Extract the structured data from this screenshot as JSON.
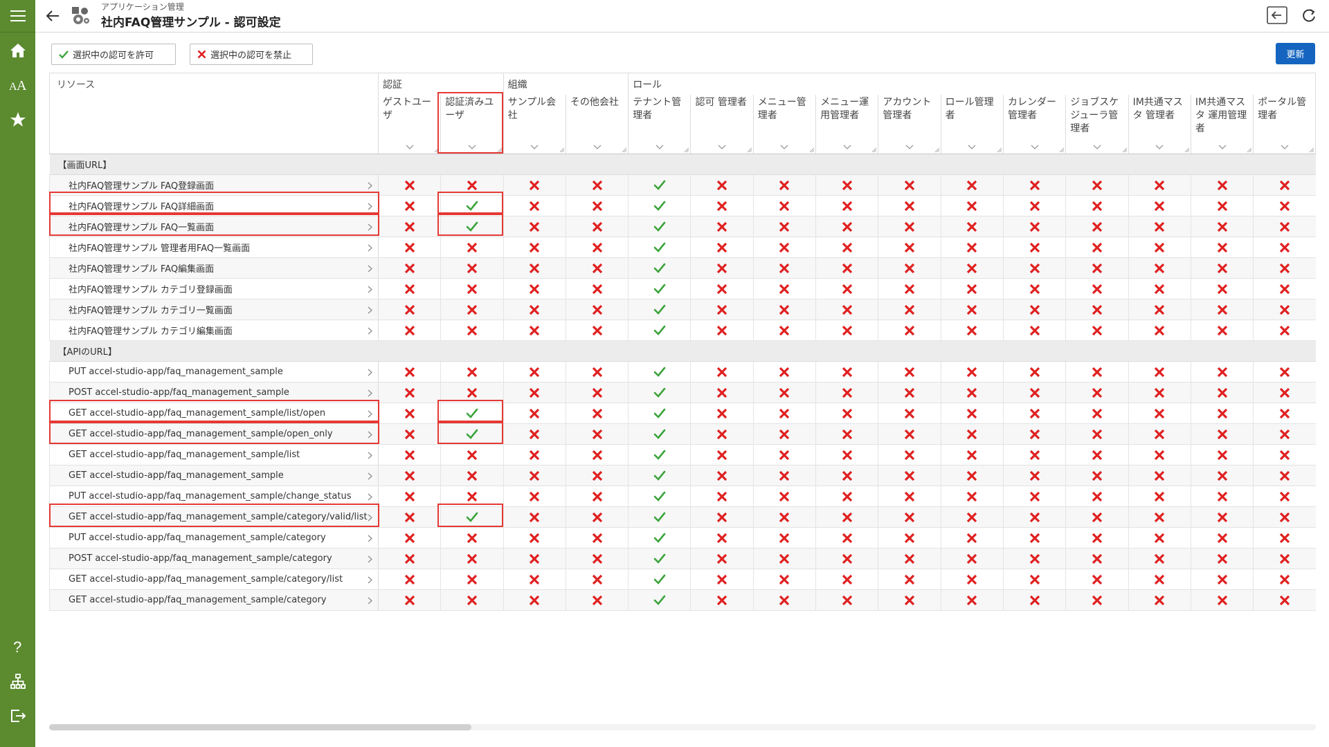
{
  "sidebar": {
    "icons": [
      "menu-icon",
      "home-icon",
      "font-size-icon",
      "star-icon",
      "help-icon",
      "sitemap-icon",
      "logout-icon"
    ]
  },
  "header": {
    "subtitle": "アプリケーション管理",
    "title": "社内FAQ管理サンプル - 認可設定"
  },
  "toolbar": {
    "allow_label": "選択中の認可を許可",
    "deny_label": "選択中の認可を禁止",
    "update_label": "更新"
  },
  "colors": {
    "sidebar": "#5b8a2f",
    "check": "#3aa33a",
    "cross": "#e02020",
    "primary": "#1565c0",
    "highlight": "#e53935"
  },
  "table": {
    "resource_header": "リソース",
    "groups": [
      {
        "label": "認証"
      },
      {
        "label": "組織"
      },
      {
        "label": "ロール"
      }
    ],
    "columns": [
      "ゲストユーザ",
      "認証済みユーザ",
      "サンプル会社",
      "その他会社",
      "テナント管理者",
      "認可 管理者",
      "メニュー管理者",
      "メニュー運用管理者",
      "アカウント管理者",
      "ロール管理者",
      "カレンダー管理者",
      "ジョブスケジューラ管理者",
      "IM共通マスタ 管理者",
      "IM共通マスタ 運用管理者",
      "ポータル管理者"
    ],
    "sections": [
      {
        "label": "【画面URL】",
        "rows": [
          {
            "resource": "社内FAQ管理サンプル FAQ登録画面",
            "auth": [
              "x",
              "x",
              "x",
              "x",
              "ok",
              "x",
              "x",
              "x",
              "x",
              "x",
              "x",
              "x",
              "x",
              "x",
              "x"
            ]
          },
          {
            "resource": "社内FAQ管理サンプル FAQ詳細画面",
            "auth": [
              "x",
              "ok",
              "x",
              "x",
              "ok",
              "x",
              "x",
              "x",
              "x",
              "x",
              "x",
              "x",
              "x",
              "x",
              "x"
            ]
          },
          {
            "resource": "社内FAQ管理サンプル FAQ一覧画面",
            "auth": [
              "x",
              "ok",
              "x",
              "x",
              "ok",
              "x",
              "x",
              "x",
              "x",
              "x",
              "x",
              "x",
              "x",
              "x",
              "x"
            ]
          },
          {
            "resource": "社内FAQ管理サンプル 管理者用FAQ一覧画面",
            "auth": [
              "x",
              "x",
              "x",
              "x",
              "ok",
              "x",
              "x",
              "x",
              "x",
              "x",
              "x",
              "x",
              "x",
              "x",
              "x"
            ]
          },
          {
            "resource": "社内FAQ管理サンプル FAQ編集画面",
            "auth": [
              "x",
              "x",
              "x",
              "x",
              "ok",
              "x",
              "x",
              "x",
              "x",
              "x",
              "x",
              "x",
              "x",
              "x",
              "x"
            ]
          },
          {
            "resource": "社内FAQ管理サンプル カテゴリ登録画面",
            "auth": [
              "x",
              "x",
              "x",
              "x",
              "ok",
              "x",
              "x",
              "x",
              "x",
              "x",
              "x",
              "x",
              "x",
              "x",
              "x"
            ]
          },
          {
            "resource": "社内FAQ管理サンプル カテゴリ一覧画面",
            "auth": [
              "x",
              "x",
              "x",
              "x",
              "ok",
              "x",
              "x",
              "x",
              "x",
              "x",
              "x",
              "x",
              "x",
              "x",
              "x"
            ]
          },
          {
            "resource": "社内FAQ管理サンプル カテゴリ編集画面",
            "auth": [
              "x",
              "x",
              "x",
              "x",
              "ok",
              "x",
              "x",
              "x",
              "x",
              "x",
              "x",
              "x",
              "x",
              "x",
              "x"
            ]
          }
        ]
      },
      {
        "label": "【APIのURL】",
        "rows": [
          {
            "resource": "PUT accel-studio-app/faq_management_sample",
            "auth": [
              "x",
              "x",
              "x",
              "x",
              "ok",
              "x",
              "x",
              "x",
              "x",
              "x",
              "x",
              "x",
              "x",
              "x",
              "x"
            ]
          },
          {
            "resource": "POST accel-studio-app/faq_management_sample",
            "auth": [
              "x",
              "x",
              "x",
              "x",
              "ok",
              "x",
              "x",
              "x",
              "x",
              "x",
              "x",
              "x",
              "x",
              "x",
              "x"
            ]
          },
          {
            "resource": "GET accel-studio-app/faq_management_sample/list/open",
            "auth": [
              "x",
              "ok",
              "x",
              "x",
              "ok",
              "x",
              "x",
              "x",
              "x",
              "x",
              "x",
              "x",
              "x",
              "x",
              "x"
            ]
          },
          {
            "resource": "GET accel-studio-app/faq_management_sample/open_only",
            "auth": [
              "x",
              "ok",
              "x",
              "x",
              "ok",
              "x",
              "x",
              "x",
              "x",
              "x",
              "x",
              "x",
              "x",
              "x",
              "x"
            ]
          },
          {
            "resource": "GET accel-studio-app/faq_management_sample/list",
            "auth": [
              "x",
              "x",
              "x",
              "x",
              "ok",
              "x",
              "x",
              "x",
              "x",
              "x",
              "x",
              "x",
              "x",
              "x",
              "x"
            ]
          },
          {
            "resource": "GET accel-studio-app/faq_management_sample",
            "auth": [
              "x",
              "x",
              "x",
              "x",
              "ok",
              "x",
              "x",
              "x",
              "x",
              "x",
              "x",
              "x",
              "x",
              "x",
              "x"
            ]
          },
          {
            "resource": "PUT accel-studio-app/faq_management_sample/change_status",
            "auth": [
              "x",
              "x",
              "x",
              "x",
              "ok",
              "x",
              "x",
              "x",
              "x",
              "x",
              "x",
              "x",
              "x",
              "x",
              "x"
            ]
          },
          {
            "resource": "GET accel-studio-app/faq_management_sample/category/valid/list",
            "auth": [
              "x",
              "ok",
              "x",
              "x",
              "ok",
              "x",
              "x",
              "x",
              "x",
              "x",
              "x",
              "x",
              "x",
              "x",
              "x"
            ]
          },
          {
            "resource": "PUT accel-studio-app/faq_management_sample/category",
            "auth": [
              "x",
              "x",
              "x",
              "x",
              "ok",
              "x",
              "x",
              "x",
              "x",
              "x",
              "x",
              "x",
              "x",
              "x",
              "x"
            ]
          },
          {
            "resource": "POST accel-studio-app/faq_management_sample/category",
            "auth": [
              "x",
              "x",
              "x",
              "x",
              "ok",
              "x",
              "x",
              "x",
              "x",
              "x",
              "x",
              "x",
              "x",
              "x",
              "x"
            ]
          },
          {
            "resource": "GET accel-studio-app/faq_management_sample/category/list",
            "auth": [
              "x",
              "x",
              "x",
              "x",
              "ok",
              "x",
              "x",
              "x",
              "x",
              "x",
              "x",
              "x",
              "x",
              "x",
              "x"
            ]
          },
          {
            "resource": "GET accel-studio-app/faq_management_sample/category",
            "auth": [
              "x",
              "x",
              "x",
              "x",
              "ok",
              "x",
              "x",
              "x",
              "x",
              "x",
              "x",
              "x",
              "x",
              "x",
              "x"
            ]
          }
        ]
      }
    ]
  }
}
